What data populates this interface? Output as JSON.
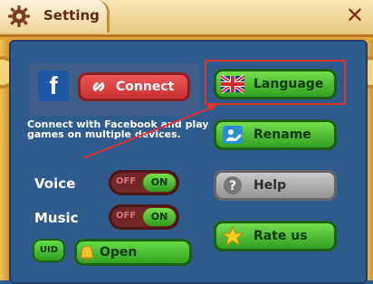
{
  "header": {
    "title": "Setting",
    "close_label": "✕"
  },
  "facebook": {
    "logo_text": "f",
    "connect_label": "Connect",
    "description": "Connect with Facebook and play games on multiple devices."
  },
  "toggles": [
    {
      "label": "Voice",
      "off_label": "OFF",
      "on_label": "ON",
      "state": "on"
    },
    {
      "label": "Music",
      "off_label": "OFF",
      "on_label": "ON",
      "state": "on"
    }
  ],
  "bottom": {
    "uid_label": "UID",
    "open_label": "Open"
  },
  "menu": [
    {
      "label": "Language",
      "icon": "uk-flag-icon",
      "style": "green"
    },
    {
      "label": "Rename",
      "icon": "rename-icon",
      "style": "green"
    },
    {
      "label": "Help",
      "icon": "help-icon",
      "style": "gray"
    },
    {
      "label": "Rate us",
      "icon": "star-icon",
      "style": "green"
    }
  ],
  "colors": {
    "panel_blue": "#2f5b8d",
    "button_green": "#2c9a1c",
    "connect_red": "#c72e2e",
    "highlight_red": "#e03131"
  }
}
